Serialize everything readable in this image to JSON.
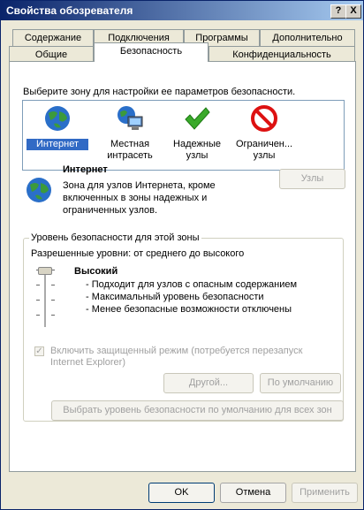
{
  "window": {
    "title": "Свойства обозревателя",
    "help_button": "?",
    "close_button": "X"
  },
  "tabs": {
    "row_top": [
      "Содержание",
      "Подключения",
      "Программы",
      "Дополнительно"
    ],
    "row_bottom": [
      "Общие",
      "Безопасность",
      "Конфиденциальность"
    ],
    "active": "Безопасность"
  },
  "security": {
    "zone_prompt": "Выберите зону для настройки ее параметров безопасности.",
    "zones": [
      {
        "label": "Интернет",
        "icon": "globe-icon",
        "selected": true
      },
      {
        "label": "Местная интрасеть",
        "icon": "intranet-icon",
        "selected": false
      },
      {
        "label": "Надежные узлы",
        "icon": "checkmark-icon",
        "selected": false
      },
      {
        "label": "Ограничен... узлы",
        "icon": "restricted-icon",
        "selected": false
      }
    ],
    "selected_zone": {
      "name": "Интернет",
      "description": "Зона для узлов Интернета, кроме включенных в зоны надежных и ограниченных узлов."
    },
    "sites_button": "Узлы",
    "level_group": {
      "title": "Уровень безопасности для этой зоны",
      "allowed_levels": "Разрешенные уровни: от среднего до высокого",
      "level_name": "Высокий",
      "level_fraction": 1.0,
      "bullets": [
        "- Подходит для узлов с опасным содержанием",
        "- Максимальный уровень безопасности",
        "- Менее безопасные возможности отключены"
      ],
      "protected_mode_label": "Включить защищенный режим (потребуется перезапуск Internet Explorer)",
      "protected_mode_checked": true,
      "custom_button": "Другой...",
      "default_button": "По умолчанию"
    },
    "reset_all_button": "Выбрать уровень безопасности по умолчанию для всех зон"
  },
  "footer": {
    "ok": "OK",
    "cancel": "Отмена",
    "apply": "Применить"
  }
}
